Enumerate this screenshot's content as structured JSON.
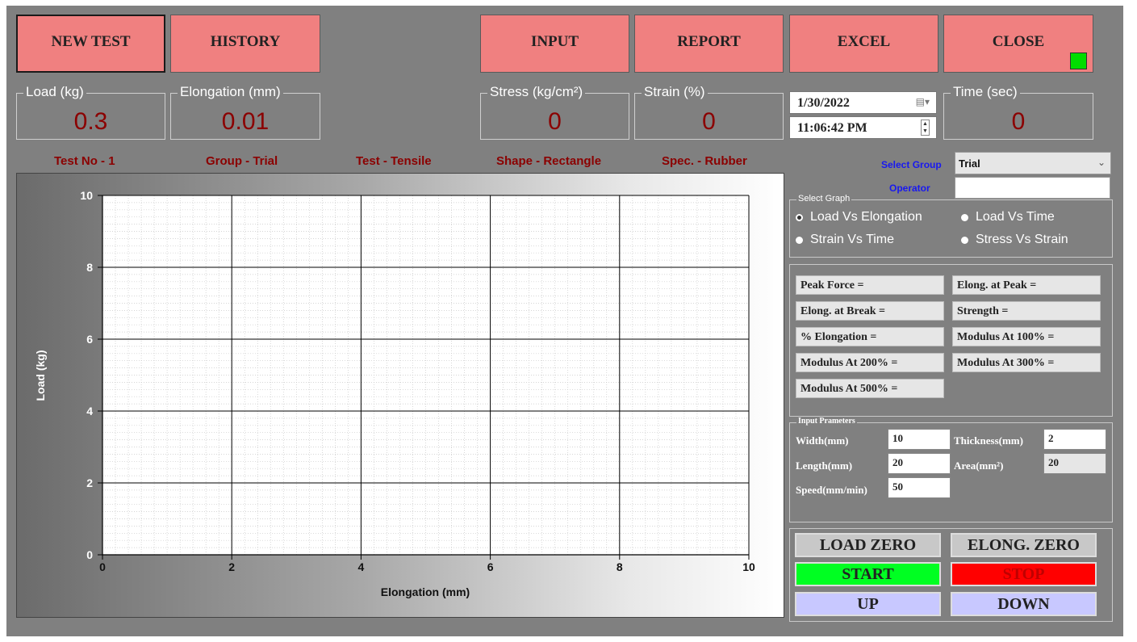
{
  "toolbar": {
    "new_test": "NEW TEST",
    "history": "HISTORY",
    "input": "INPUT",
    "report": "REPORT",
    "excel": "EXCEL",
    "close": "CLOSE",
    "accent_color": "#f08080",
    "indicator_color": "#00dd00"
  },
  "readouts": {
    "load": {
      "label": "Load (kg)",
      "value": "0.3"
    },
    "elongation": {
      "label": "Elongation (mm)",
      "value": "0.01"
    },
    "stress": {
      "label": "Stress (kg/cm²)",
      "value": "0"
    },
    "strain": {
      "label": "Strain (%)",
      "value": "0"
    },
    "time": {
      "label": "Time (sec)",
      "value": "0"
    }
  },
  "datetime": {
    "date": "1/30/2022",
    "time": "11:06:42 PM"
  },
  "test_info": {
    "test_no": "Test No - 1",
    "group": "Group - Trial",
    "test": "Test - Tensile",
    "shape": "Shape - Rectangle",
    "spec": "Spec. - Rubber"
  },
  "group_select": {
    "label": "Select Group",
    "value": "Trial"
  },
  "operator": {
    "label": "Operator",
    "value": ""
  },
  "select_graph": {
    "legend": "Select Graph",
    "options": [
      "Load Vs Elongation",
      "Load Vs Time",
      "Strain Vs Time",
      "Stress Vs Strain"
    ],
    "selected": "Load Vs Elongation"
  },
  "results": {
    "peak_force": "Peak Force =",
    "elong_at_peak": "Elong. at Peak =",
    "elong_at_break": "Elong. at Break =",
    "strength": "Strength =",
    "pct_elongation": "% Elongation =",
    "modulus_100": "Modulus At 100% =",
    "modulus_200": "Modulus At 200% =",
    "modulus_300": "Modulus At 300% =",
    "modulus_500": "Modulus At 500% ="
  },
  "input_params": {
    "legend": "Input Prameters",
    "width_label": "Width(mm)",
    "width": "10",
    "thickness_label": "Thickness(mm)",
    "thickness": "2",
    "length_label": "Length(mm)",
    "length": "20",
    "area_label": "Area(mm²)",
    "area": "20",
    "speed_label": "Speed(mm/min)",
    "speed": "50"
  },
  "controls": {
    "load_zero": "LOAD ZERO",
    "elong_zero": "ELONG. ZERO",
    "start": "START",
    "stop": "STOP",
    "up": "UP",
    "down": "DOWN",
    "start_color": "#00ff22",
    "stop_color": "#ff0000",
    "jog_color": "#c8c8ff"
  },
  "chart_data": {
    "type": "line",
    "xlabel": "Elongation (mm)",
    "ylabel": "Load (kg)",
    "xlim": [
      0,
      10
    ],
    "ylim": [
      0,
      10
    ],
    "xticks": [
      0,
      2,
      4,
      6,
      8,
      10
    ],
    "yticks": [
      0,
      2,
      4,
      6,
      8,
      10
    ],
    "series": [],
    "grid": true
  }
}
